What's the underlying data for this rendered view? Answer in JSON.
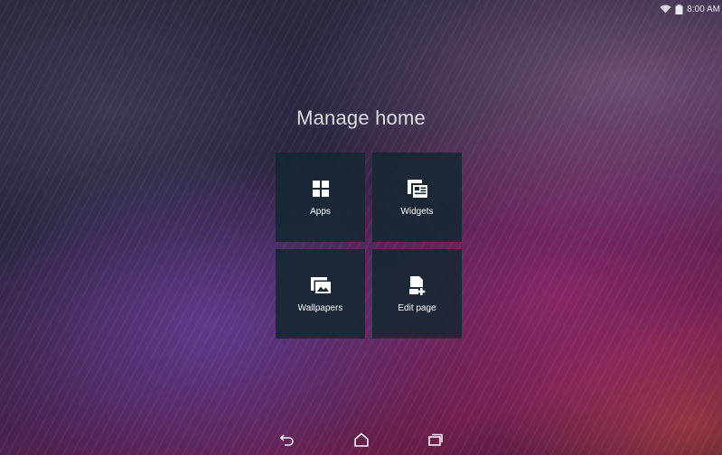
{
  "status_bar": {
    "time": "8:00 AM",
    "wifi_icon": "wifi-icon",
    "battery_icon": "battery-icon"
  },
  "manage_home": {
    "title": "Manage home",
    "tiles": [
      {
        "label": "Apps",
        "icon": "apps-grid-icon"
      },
      {
        "label": "Widgets",
        "icon": "widgets-icon"
      },
      {
        "label": "Wallpapers",
        "icon": "wallpapers-icon"
      },
      {
        "label": "Edit page",
        "icon": "edit-page-icon"
      }
    ]
  },
  "nav_bar": {
    "back_icon": "back-icon",
    "home_icon": "home-icon",
    "recents_icon": "recent-apps-icon"
  },
  "colors": {
    "tile_background": "#182834",
    "text": "#ffffff"
  }
}
